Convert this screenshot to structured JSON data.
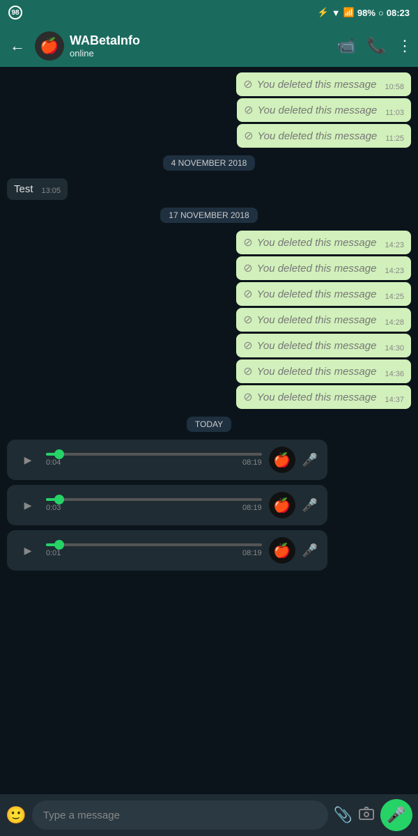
{
  "statusBar": {
    "leftIcon": "98",
    "battery": "98%",
    "time": "08:23"
  },
  "header": {
    "name": "WABetaInfo",
    "status": "online",
    "avatarEmoji": "🍎"
  },
  "messages": [
    {
      "type": "deleted",
      "time": "10:58"
    },
    {
      "type": "deleted",
      "time": "11:03"
    },
    {
      "type": "deleted",
      "time": "11:25"
    },
    {
      "type": "date",
      "label": "4 NOVEMBER 2018"
    },
    {
      "type": "received",
      "text": "Test",
      "time": "13:05"
    },
    {
      "type": "date",
      "label": "17 NOVEMBER 2018"
    },
    {
      "type": "deleted",
      "time": "14:23"
    },
    {
      "type": "deleted",
      "time": "14:23"
    },
    {
      "type": "deleted",
      "time": "14:25"
    },
    {
      "type": "deleted",
      "time": "14:28"
    },
    {
      "type": "deleted",
      "time": "14:30"
    },
    {
      "type": "deleted",
      "time": "14:36"
    },
    {
      "type": "deleted",
      "time": "14:37"
    },
    {
      "type": "date",
      "label": "TODAY"
    },
    {
      "type": "voice",
      "duration": "0:04",
      "sendTime": "08:19"
    },
    {
      "type": "voice",
      "duration": "0:03",
      "sendTime": "08:19"
    },
    {
      "type": "voice",
      "duration": "0:01",
      "sendTime": "08:19"
    }
  ],
  "deletedText": "You deleted this message",
  "inputBar": {
    "placeholder": "Type a message"
  },
  "icons": {
    "back": "←",
    "video": "📹",
    "phone": "📞",
    "more": "⋮",
    "emoji": "🙂",
    "attach": "📎",
    "camera": "⬜",
    "mic": "🎤",
    "play": "▶",
    "ban": "🚫"
  }
}
